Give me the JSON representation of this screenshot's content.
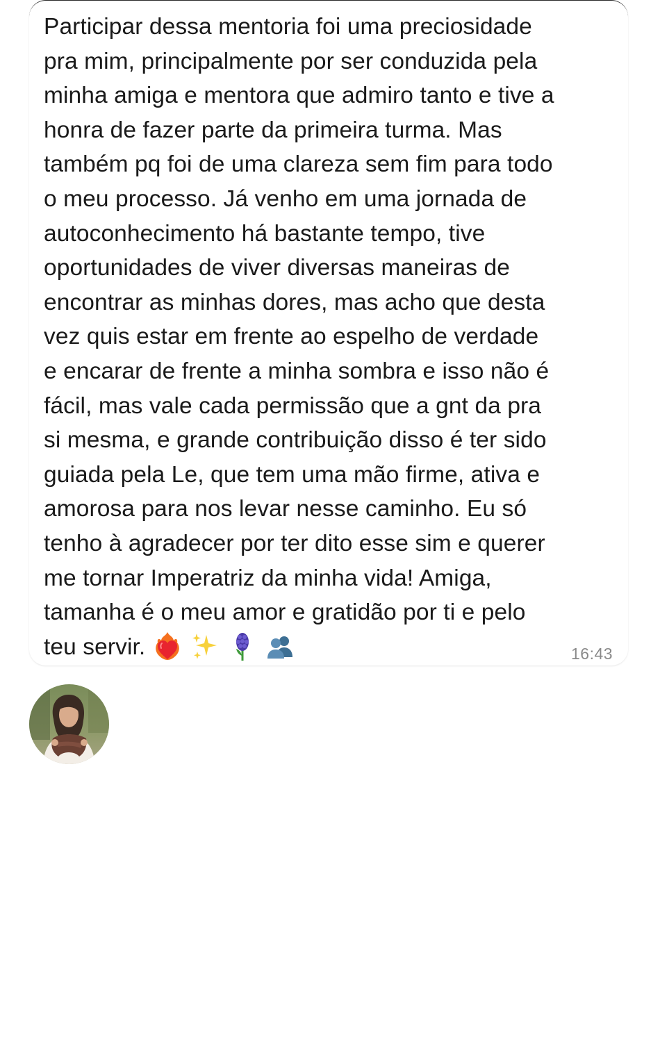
{
  "message": {
    "lines": [
      "Participar dessa mentoria foi uma preciosidade",
      "pra mim, principalmente por ser conduzida pela",
      "minha amiga e mentora que admiro tanto e tive a",
      "honra de fazer parte da primeira turma. Mas",
      "também pq foi de uma clareza sem fim para todo",
      "o meu processo. Já venho em uma jornada de",
      "autoconhecimento há bastante tempo, tive",
      "oportunidades de viver diversas maneiras de",
      "encontrar as minhas dores, mas acho que desta",
      "vez quis estar em frente ao espelho de verdade",
      "e encarar de frente a minha sombra e isso não é",
      "fácil, mas vale cada permissão que a gnt da pra",
      "si mesma, e grande contribuição disso é ter sido",
      "guiada pela Le, que tem uma mão firme, ativa e",
      "amorosa para nos levar nesse caminho. Eu só",
      "tenho à agradecer por ter dito esse sim e querer",
      "me tornar Imperatriz da minha vida! Amiga,",
      "tamanha é o meu amor e gratidão por ti e pelo",
      "teu servir."
    ],
    "emojis": [
      "heart-on-fire-emoji",
      "sparkles-emoji",
      "hyacinth-emoji",
      "busts-emoji"
    ],
    "timestamp": "16:43"
  },
  "sender": {
    "avatar": "sender-avatar-photo"
  }
}
